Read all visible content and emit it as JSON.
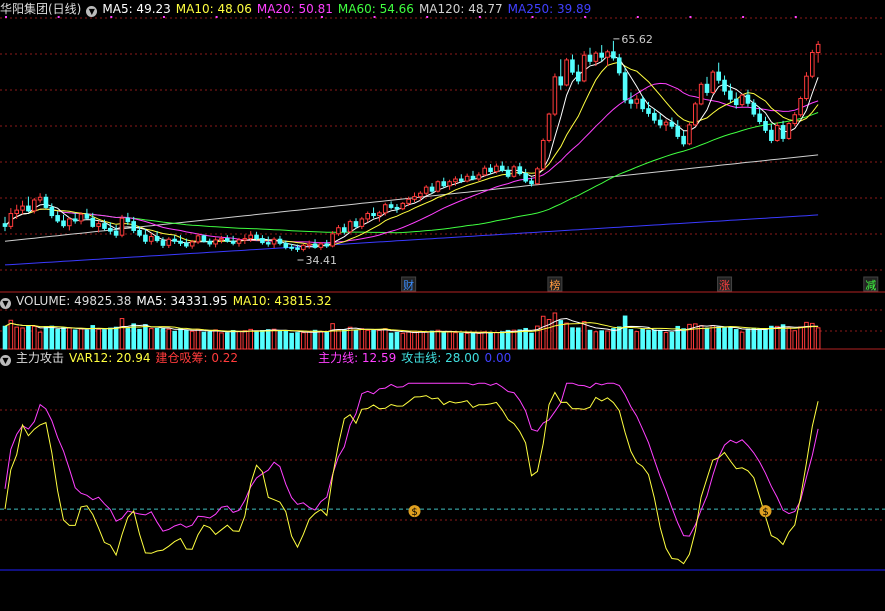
{
  "header_main": {
    "title": "华阳集团(日线)",
    "ma5": "MA5: 49.23",
    "ma10": "MA10: 48.06",
    "ma20": "MA20: 50.81",
    "ma60": "MA60: 54.66",
    "ma120": "MA120: 48.77",
    "ma250": "MA250: 39.89"
  },
  "header_vol": {
    "volume": "VOLUME: 49825.38",
    "ma5": "MA5: 34331.95",
    "ma10": "MA10: 43815.32"
  },
  "header_ind": {
    "title": "主力攻击",
    "var12": "VAR12: 20.94",
    "jiancang": "建仓吸筹: 0.22",
    "zhuli": "主力线: 12.59",
    "gongji": "攻击线: 28.00",
    "extra": "0.00"
  },
  "colors": {
    "up": "#ff3b3b",
    "down": "#54ffff",
    "ma5": "#ffffff",
    "ma10": "#ffff40",
    "ma20": "#ff40ff",
    "ma60": "#40ff40",
    "ma120": "#cfcfcf",
    "ma250": "#3a3aff",
    "grid": "#8b1a1a",
    "border": "#b22222"
  },
  "chart_data": [
    {
      "type": "candlestick",
      "title": "华阳集团(日线)",
      "annotations": [
        {
          "label": "65.62",
          "kind": "high",
          "index": 104
        },
        {
          "label": "34.41",
          "kind": "low",
          "index": 50
        }
      ],
      "event_tags": [
        {
          "label": "财",
          "index": 69,
          "color": "#3a8dff"
        },
        {
          "label": "榜",
          "index": 94,
          "color": "#ff9a40"
        },
        {
          "label": "涨",
          "index": 123,
          "color": "#ff4040"
        },
        {
          "label": "减",
          "index": 148,
          "color": "#40ff40"
        }
      ],
      "ylim": [
        28.5,
        69.0
      ],
      "candles": [
        [
          38.6,
          39.6,
          37.5,
          38.2
        ],
        [
          38.2,
          40.9,
          37.8,
          40.1
        ],
        [
          40.1,
          41.4,
          39.3,
          40.6
        ],
        [
          40.6,
          42.0,
          40.0,
          41.2
        ],
        [
          41.2,
          42.6,
          40.3,
          40.5
        ],
        [
          40.5,
          42.4,
          40.1,
          42.1
        ],
        [
          42.1,
          43.1,
          41.7,
          42.5
        ],
        [
          42.5,
          43.0,
          40.8,
          41.0
        ],
        [
          41.0,
          41.6,
          39.4,
          39.8
        ],
        [
          39.8,
          40.4,
          38.7,
          39.0
        ],
        [
          39.0,
          39.9,
          38.0,
          38.3
        ],
        [
          38.3,
          39.5,
          37.6,
          39.3
        ],
        [
          39.3,
          40.2,
          38.6,
          39.0
        ],
        [
          39.0,
          40.3,
          38.5,
          40.0
        ],
        [
          40.0,
          40.8,
          39.2,
          39.4
        ],
        [
          39.4,
          40.2,
          38.0,
          38.2
        ],
        [
          38.2,
          39.0,
          37.3,
          38.6
        ],
        [
          38.6,
          39.2,
          37.6,
          37.9
        ],
        [
          37.9,
          38.8,
          37.0,
          37.5
        ],
        [
          37.5,
          38.4,
          36.5,
          36.9
        ],
        [
          36.9,
          39.9,
          36.6,
          39.4
        ],
        [
          39.4,
          40.2,
          38.4,
          38.9
        ],
        [
          38.9,
          39.6,
          37.2,
          37.6
        ],
        [
          37.6,
          38.2,
          36.6,
          36.9
        ],
        [
          36.9,
          37.8,
          35.6,
          36.0
        ],
        [
          36.0,
          37.2,
          35.5,
          36.7
        ],
        [
          36.7,
          37.5,
          35.8,
          36.1
        ],
        [
          36.1,
          36.6,
          35.0,
          35.4
        ],
        [
          35.4,
          36.6,
          35.0,
          36.3
        ],
        [
          36.3,
          36.9,
          35.6,
          36.0
        ],
        [
          36.0,
          36.9,
          35.3,
          35.7
        ],
        [
          35.7,
          36.4,
          35.0,
          35.3
        ],
        [
          35.3,
          36.2,
          34.9,
          35.9
        ],
        [
          35.9,
          37.2,
          35.6,
          36.8
        ],
        [
          36.8,
          37.0,
          35.8,
          36.0
        ],
        [
          36.0,
          36.4,
          35.2,
          35.6
        ],
        [
          35.6,
          36.6,
          35.1,
          36.2
        ],
        [
          36.2,
          36.8,
          35.7,
          36.4
        ],
        [
          36.4,
          36.9,
          35.8,
          36.0
        ],
        [
          36.0,
          36.8,
          35.4,
          35.7
        ],
        [
          35.7,
          36.5,
          35.2,
          36.2
        ],
        [
          36.2,
          37.0,
          35.6,
          36.4
        ],
        [
          36.4,
          37.5,
          35.9,
          36.9
        ],
        [
          36.9,
          37.4,
          36.1,
          36.4
        ],
        [
          36.4,
          36.9,
          35.5,
          35.8
        ],
        [
          35.8,
          36.7,
          35.2,
          35.6
        ],
        [
          35.6,
          36.6,
          35.0,
          36.3
        ],
        [
          36.3,
          36.8,
          35.4,
          35.7
        ],
        [
          35.7,
          36.1,
          34.8,
          35.1
        ],
        [
          35.1,
          35.6,
          34.6,
          35.0
        ],
        [
          35.0,
          35.5,
          34.41,
          34.8
        ],
        [
          34.8,
          35.6,
          34.5,
          35.4
        ],
        [
          35.4,
          36.1,
          34.9,
          35.6
        ],
        [
          35.6,
          36.3,
          34.9,
          35.1
        ],
        [
          35.1,
          35.9,
          34.7,
          35.6
        ],
        [
          35.6,
          36.2,
          35.0,
          35.3
        ],
        [
          35.3,
          37.5,
          35.1,
          37.1
        ],
        [
          37.1,
          38.4,
          36.8,
          38.0
        ],
        [
          38.0,
          38.6,
          37.0,
          37.4
        ],
        [
          37.4,
          39.2,
          37.2,
          38.9
        ],
        [
          38.9,
          39.4,
          37.9,
          38.2
        ],
        [
          38.2,
          39.6,
          37.8,
          39.3
        ],
        [
          39.3,
          40.4,
          38.8,
          40.1
        ],
        [
          40.1,
          41.0,
          39.4,
          39.8
        ],
        [
          39.8,
          40.5,
          38.9,
          40.2
        ],
        [
          40.2,
          41.7,
          39.8,
          41.4
        ],
        [
          41.4,
          41.9,
          40.7,
          41.0
        ],
        [
          41.0,
          41.5,
          40.2,
          40.8
        ],
        [
          40.8,
          41.8,
          40.6,
          41.6
        ],
        [
          41.6,
          42.6,
          41.2,
          42.2
        ],
        [
          42.2,
          43.2,
          41.8,
          42.6
        ],
        [
          42.6,
          43.4,
          41.9,
          43.1
        ],
        [
          43.1,
          44.3,
          42.8,
          44.0
        ],
        [
          44.0,
          44.6,
          43.0,
          43.4
        ],
        [
          43.4,
          45.0,
          43.2,
          44.8
        ],
        [
          44.8,
          45.4,
          43.9,
          44.2
        ],
        [
          44.2,
          45.1,
          43.6,
          44.8
        ],
        [
          44.8,
          45.6,
          44.2,
          45.2
        ],
        [
          45.2,
          45.9,
          44.6,
          44.9
        ],
        [
          44.9,
          46.0,
          44.7,
          45.6
        ],
        [
          45.6,
          46.4,
          45.0,
          45.2
        ],
        [
          45.2,
          46.2,
          44.9,
          45.8
        ],
        [
          45.8,
          47.2,
          45.6,
          46.8
        ],
        [
          46.8,
          47.4,
          45.9,
          46.3
        ],
        [
          46.3,
          47.5,
          46.0,
          47.1
        ],
        [
          47.1,
          47.8,
          46.2,
          46.5
        ],
        [
          46.5,
          47.1,
          45.3,
          45.6
        ],
        [
          45.6,
          47.3,
          45.4,
          47.0
        ],
        [
          47.0,
          47.6,
          45.7,
          46.0
        ],
        [
          46.0,
          46.7,
          44.6,
          44.9
        ],
        [
          44.9,
          45.4,
          44.1,
          44.5
        ],
        [
          44.5,
          47.0,
          44.4,
          46.7
        ],
        [
          46.7,
          51.2,
          46.5,
          50.9
        ],
        [
          50.9,
          55.0,
          50.6,
          54.8
        ],
        [
          54.8,
          60.8,
          54.5,
          60.3
        ],
        [
          60.3,
          62.9,
          58.4,
          59.1
        ],
        [
          59.1,
          63.1,
          58.9,
          62.8
        ],
        [
          62.8,
          63.6,
          60.6,
          61.0
        ],
        [
          61.0,
          62.1,
          59.2,
          59.7
        ],
        [
          59.7,
          64.1,
          59.5,
          63.5
        ],
        [
          63.5,
          64.6,
          62.1,
          62.6
        ],
        [
          62.6,
          64.1,
          61.9,
          63.8
        ],
        [
          63.8,
          65.0,
          62.6,
          63.2
        ],
        [
          63.2,
          64.3,
          61.9,
          64.0
        ],
        [
          64.0,
          65.62,
          62.7,
          63.1
        ],
        [
          63.1,
          63.7,
          60.5,
          60.9
        ],
        [
          60.9,
          61.7,
          56.4,
          56.9
        ],
        [
          56.9,
          58.0,
          55.6,
          56.4
        ],
        [
          56.4,
          57.6,
          55.6,
          57.0
        ],
        [
          57.0,
          57.5,
          55.1,
          55.6
        ],
        [
          55.6,
          56.6,
          54.4,
          54.9
        ],
        [
          54.9,
          55.6,
          53.4,
          53.9
        ],
        [
          53.9,
          54.8,
          52.7,
          53.2
        ],
        [
          53.2,
          54.0,
          52.3,
          53.6
        ],
        [
          53.6,
          54.3,
          52.6,
          53.0
        ],
        [
          53.0,
          53.9,
          51.1,
          51.5
        ],
        [
          51.5,
          52.3,
          50.0,
          50.4
        ],
        [
          50.4,
          53.5,
          50.2,
          53.2
        ],
        [
          53.2,
          56.6,
          53.0,
          56.3
        ],
        [
          56.3,
          59.5,
          56.1,
          59.2
        ],
        [
          59.2,
          60.3,
          57.5,
          58.0
        ],
        [
          58.0,
          61.3,
          57.8,
          61.0
        ],
        [
          61.0,
          62.4,
          59.3,
          59.8
        ],
        [
          59.8,
          60.5,
          57.6,
          58.2
        ],
        [
          58.2,
          59.3,
          56.5,
          57.0
        ],
        [
          57.0,
          58.0,
          55.6,
          56.2
        ],
        [
          56.2,
          57.8,
          55.9,
          57.6
        ],
        [
          57.6,
          58.4,
          55.9,
          56.4
        ],
        [
          56.4,
          57.0,
          54.4,
          54.8
        ],
        [
          54.8,
          55.7,
          53.3,
          53.7
        ],
        [
          53.7,
          54.4,
          52.0,
          52.4
        ],
        [
          52.4,
          53.3,
          50.5,
          50.9
        ],
        [
          50.9,
          53.6,
          50.7,
          53.1
        ],
        [
          53.1,
          53.8,
          50.7,
          51.2
        ],
        [
          51.2,
          53.6,
          51.0,
          53.4
        ],
        [
          53.4,
          55.1,
          53.0,
          54.7
        ],
        [
          54.7,
          57.4,
          54.4,
          57.1
        ],
        [
          57.1,
          61.0,
          56.8,
          60.4
        ],
        [
          60.4,
          64.3,
          60.1,
          63.9
        ],
        [
          63.9,
          65.6,
          62.4,
          65.1
        ]
      ]
    },
    {
      "type": "bar",
      "title": "VOLUME",
      "ylim": [
        0,
        70000
      ]
    },
    {
      "type": "line",
      "title": "主力攻击",
      "ylim": [
        0,
        100
      ],
      "reference_lines": [
        {
          "y": 30,
          "style": "dashed",
          "color": "#40c0c0"
        },
        {
          "y": 0,
          "style": "solid",
          "color": "#2020ff"
        }
      ],
      "markers": [
        {
          "index": 70,
          "value": 29,
          "label": "$"
        },
        {
          "index": 130,
          "value": 29,
          "label": "$"
        }
      ]
    }
  ]
}
